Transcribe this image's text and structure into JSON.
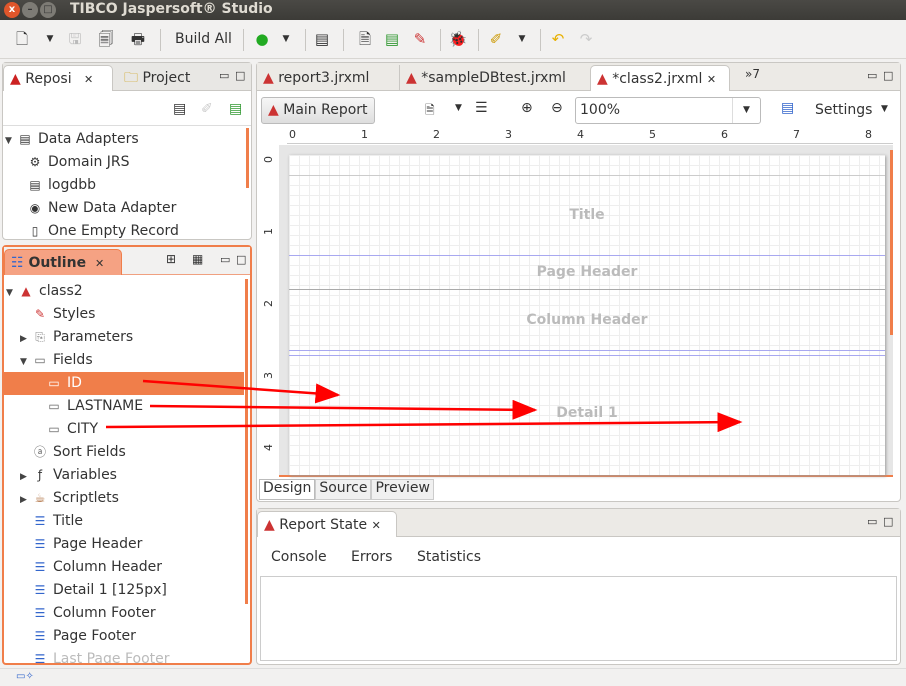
{
  "window": {
    "title": "TIBCO Jaspersoft® Studio"
  },
  "toolbar": {
    "build_all": "Build All"
  },
  "repository": {
    "tabs": [
      {
        "label": "Reposi"
      },
      {
        "label": "Project"
      }
    ],
    "items": [
      {
        "label": "Data Adapters"
      },
      {
        "label": "Domain JRS"
      },
      {
        "label": "logdbb"
      },
      {
        "label": "New Data Adapter"
      },
      {
        "label": "One Empty Record"
      }
    ]
  },
  "outline": {
    "tab": "Outline",
    "items": [
      {
        "label": "class2"
      },
      {
        "label": "Styles"
      },
      {
        "label": "Parameters"
      },
      {
        "label": "Fields"
      },
      {
        "label": "ID"
      },
      {
        "label": "LASTNAME"
      },
      {
        "label": "CITY"
      },
      {
        "label": "Sort Fields"
      },
      {
        "label": "Variables"
      },
      {
        "label": "Scriptlets"
      },
      {
        "label": "Title"
      },
      {
        "label": "Page Header"
      },
      {
        "label": "Column Header"
      },
      {
        "label": "Detail 1 [125px]"
      },
      {
        "label": "Column Footer"
      },
      {
        "label": "Page Footer"
      },
      {
        "label": "Last Page Footer"
      }
    ],
    "selected": "ID"
  },
  "editor": {
    "tabs": [
      {
        "label": "report3.jrxml"
      },
      {
        "label": "*sampleDBtest.jrxml"
      },
      {
        "label": "*class2.jrxml"
      }
    ],
    "overflow": "»7",
    "main_report": "Main Report",
    "zoom": "100%",
    "settings": "Settings",
    "ruler_h": [
      "0",
      "1",
      "2",
      "3",
      "4",
      "5",
      "6",
      "7",
      "8"
    ],
    "ruler_v": [
      "0",
      "1",
      "2",
      "3",
      "4"
    ],
    "bands": {
      "title": "Title",
      "page_header": "Page Header",
      "column_header": "Column Header",
      "detail": "Detail 1"
    },
    "bottom_tabs": [
      {
        "label": "Design"
      },
      {
        "label": "Source"
      },
      {
        "label": "Preview"
      }
    ]
  },
  "report_state": {
    "title": "Report State",
    "tabs": [
      {
        "label": "Console"
      },
      {
        "label": "Errors"
      },
      {
        "label": "Statistics"
      }
    ]
  },
  "colors": {
    "accent": "#f07e4a",
    "arrow": "#ff0000"
  }
}
